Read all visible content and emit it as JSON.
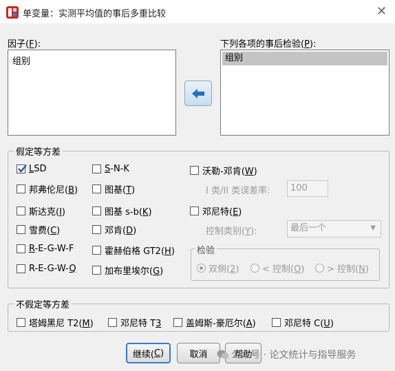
{
  "window": {
    "title": "单变量：实测平均值的事后多重比较",
    "close_icon": "close-icon"
  },
  "factors": {
    "label": "因子(F):",
    "items": [
      "组别"
    ]
  },
  "posthoc": {
    "label": "下列各项的事后检验(P):",
    "items": [
      "组别"
    ]
  },
  "equal_variances": {
    "legend": "假定等方差",
    "options": {
      "lsd": {
        "label": "LSD",
        "checked": true
      },
      "snk": {
        "label": "S-N-K",
        "checked": false
      },
      "waller": {
        "label": "沃勒-邓肯(W)",
        "checked": false
      },
      "bonferroni": {
        "label": "邦弗伦尼(B)",
        "checked": false
      },
      "tukey": {
        "label": "图基(T)",
        "checked": false
      },
      "sidak": {
        "label": "斯达克(I)",
        "checked": false
      },
      "tukey_b": {
        "label": "图基 s-b(K)",
        "checked": false
      },
      "dunnett": {
        "label": "邓尼特(E)",
        "checked": false
      },
      "scheffe": {
        "label": "雪费(C)",
        "checked": false
      },
      "duncan": {
        "label": "邓肯(D)",
        "checked": false
      },
      "regwf": {
        "label": "R-E-G-W-F",
        "checked": false
      },
      "hochberg": {
        "label": "霍赫伯格 GT2(H)",
        "checked": false
      },
      "regwq": {
        "label": "R-E-G-W-Q",
        "checked": false
      },
      "gabriel": {
        "label": "加布里埃尔(G)",
        "checked": false
      }
    },
    "type_error_label": "I 类/II 类误差率:",
    "type_error_value": "100",
    "control_category_label": "控制类别(Y):",
    "control_category_value": "最后一个",
    "test_legend": "检验",
    "test_options": [
      "双侧(2)",
      "< 控制(O)",
      "> 控制(N)"
    ]
  },
  "unequal_variances": {
    "legend": "不假定等方差",
    "options": {
      "tamhane": {
        "label": "塔姆黑尼 T2(M)",
        "checked": false
      },
      "dunnett_t3": {
        "label": "邓尼特 T3",
        "checked": false
      },
      "games_howell": {
        "label": "盖姆斯-豪厄尔(A)",
        "checked": false
      },
      "dunnett_c": {
        "label": "邓尼特 C(U)",
        "checked": false
      }
    }
  },
  "buttons": {
    "continue": "继续(C)",
    "cancel": "取消",
    "help": "帮助"
  },
  "watermark": "公众号 · 论文统计与指导服务"
}
